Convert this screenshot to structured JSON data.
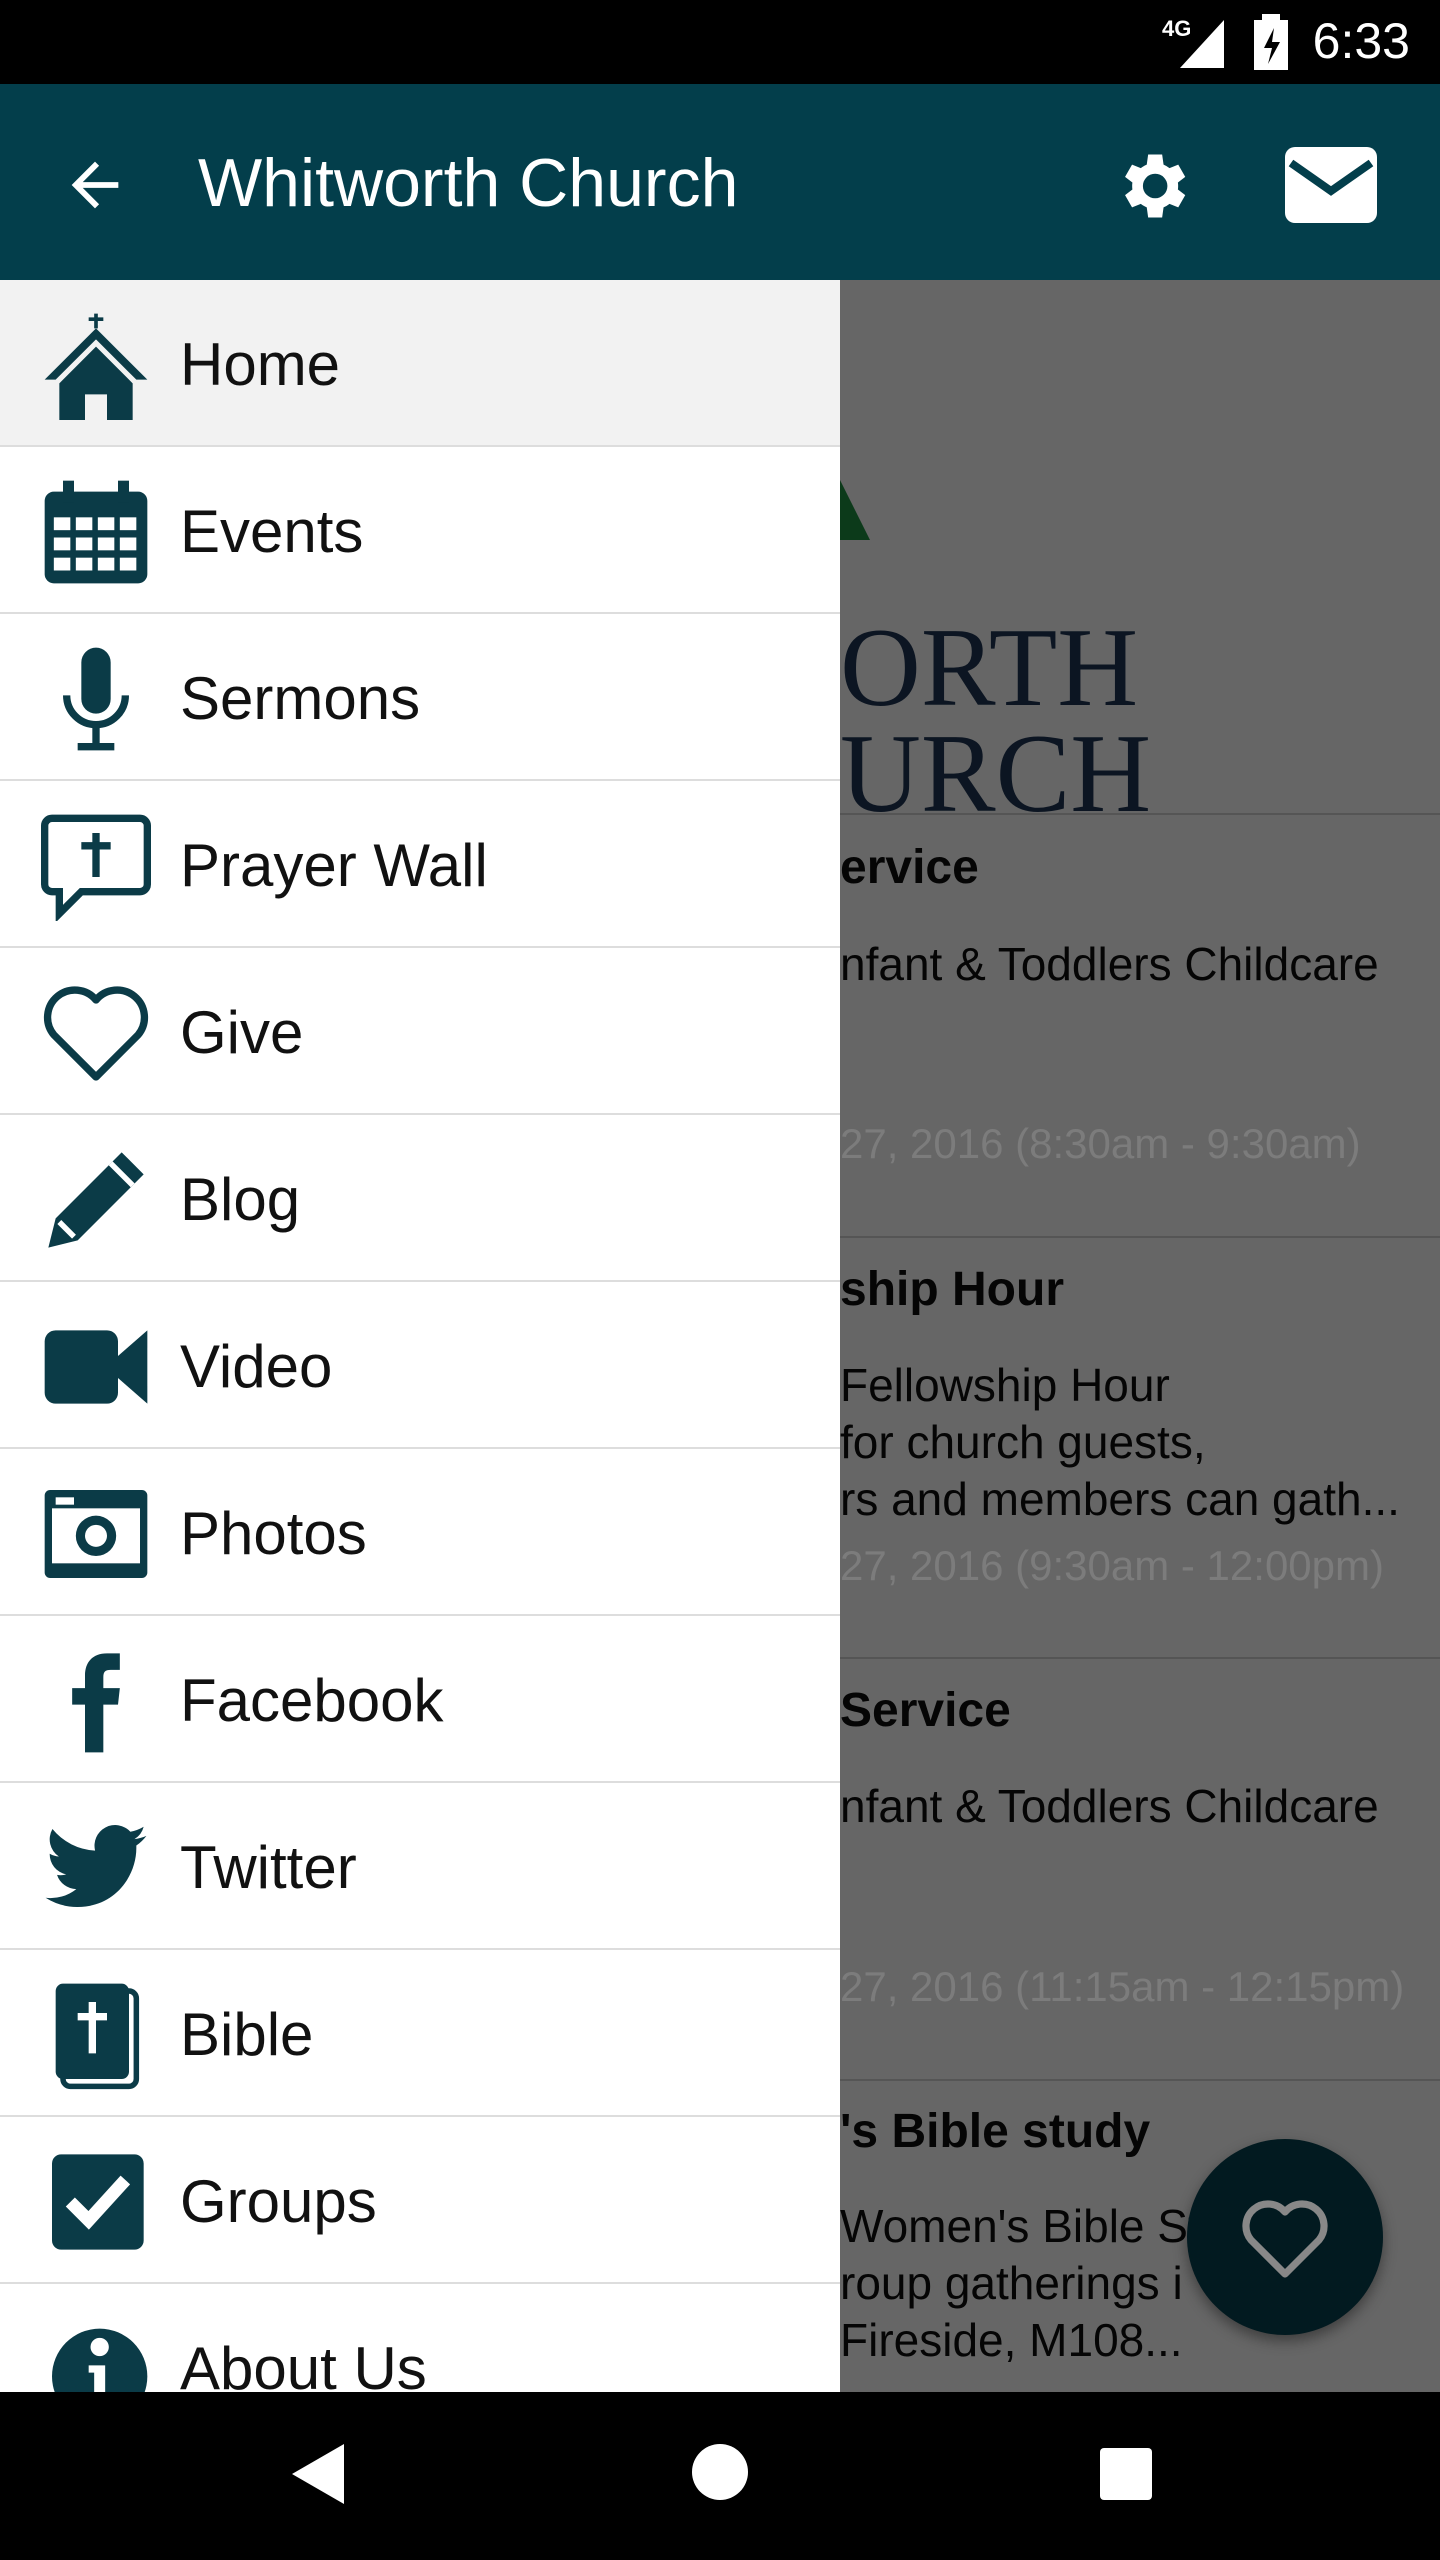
{
  "status_bar": {
    "network": "4G",
    "time": "6:33"
  },
  "app_bar": {
    "title": "Whitworth Church",
    "icons": [
      "back-arrow-icon",
      "gear-icon",
      "mail-icon"
    ]
  },
  "background": {
    "logo_lines": [
      "ORTH",
      "URCH"
    ],
    "events": [
      {
        "title": "ervice",
        "desc": [
          "nfant & Toddlers Childcare"
        ],
        "date": "27, 2016 (8:30am - 9:30am)"
      },
      {
        "title": "ship Hour",
        "desc": [
          "Fellowship Hour",
          "for church guests,",
          "rs and members can gath..."
        ],
        "date": "27, 2016 (9:30am - 12:00pm)"
      },
      {
        "title": "Service",
        "desc": [
          "nfant & Toddlers Childcare"
        ],
        "date": "27, 2016 (11:15am - 12:15pm)"
      },
      {
        "title": "'s Bible study",
        "desc": [
          "Women's Bible St",
          "roup gatherings i",
          "Fireside, M108..."
        ],
        "date": ""
      }
    ],
    "fab_icon": "heart-icon"
  },
  "drawer": {
    "items": [
      {
        "label": "Home",
        "icon": "home-icon"
      },
      {
        "label": "Events",
        "icon": "calendar-icon"
      },
      {
        "label": "Sermons",
        "icon": "microphone-icon"
      },
      {
        "label": "Prayer Wall",
        "icon": "prayer-bubble-icon"
      },
      {
        "label": "Give",
        "icon": "heart-icon"
      },
      {
        "label": "Blog",
        "icon": "pencil-icon"
      },
      {
        "label": "Video",
        "icon": "video-camera-icon"
      },
      {
        "label": "Photos",
        "icon": "camera-icon"
      },
      {
        "label": "Facebook",
        "icon": "facebook-icon"
      },
      {
        "label": "Twitter",
        "icon": "twitter-icon"
      },
      {
        "label": "Bible",
        "icon": "bible-icon"
      },
      {
        "label": "Groups",
        "icon": "checkbox-icon"
      },
      {
        "label": "About Us",
        "icon": "info-icon"
      }
    ]
  },
  "colors": {
    "primary": "#033e4b",
    "icon": "#0b3b47",
    "logo_green": "#1f7a3a"
  }
}
